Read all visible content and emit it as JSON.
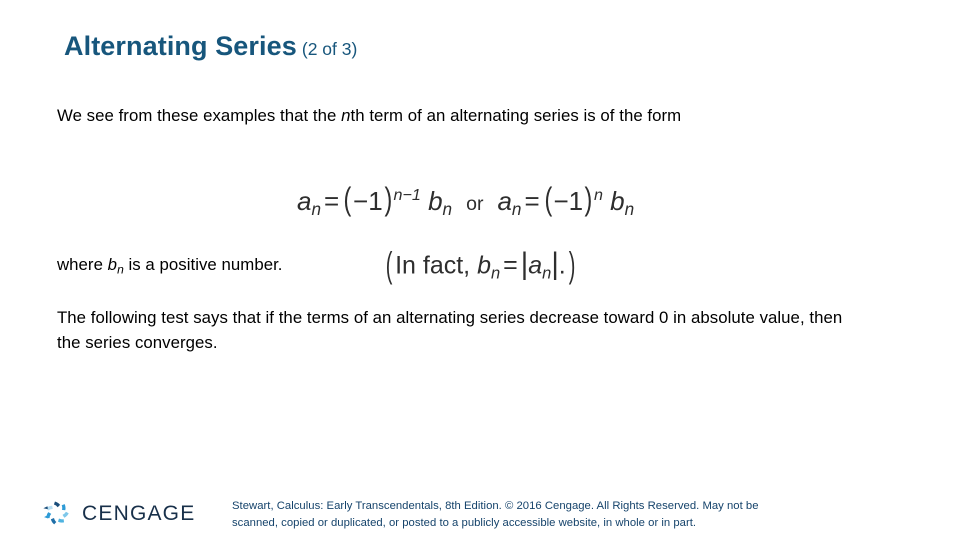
{
  "slide": {
    "title": "Alternating Series",
    "title_subtitle": "(2 of 3)",
    "title_color": "#17567c",
    "background_color": "#ffffff"
  },
  "body": {
    "paragraph_1": {
      "before_italic": "We see from these examples that the ",
      "italic_var": "n",
      "after_italic": "th term of an alternating series is of the form",
      "full_text": "We see from these examples that the nth term of an alternating series is of the form"
    },
    "where_line": {
      "prefix": "where ",
      "var": "b",
      "var_sub": "n",
      "suffix": " is a positive number.",
      "full_text": "where bn is a positive number."
    },
    "paragraph_2": "The following test says that if the terms of an alternating series decrease toward 0 in absolute value, then the series converges."
  },
  "equations": {
    "main": {
      "lhs_var_1": "a",
      "lhs_sub_1": "n",
      "equals": "=",
      "open_paren": "(",
      "minus_one": "−1",
      "close_paren": ")",
      "exponent_1": "n−1",
      "rhs_var_1": "b",
      "rhs_sub_1": "n",
      "connector": "or",
      "lhs_var_2": "a",
      "lhs_sub_2": "n",
      "exponent_2": "n",
      "rhs_var_2": "b",
      "rhs_sub_2": "n",
      "plain_text": "a_n = (−1)^(n−1) b_n   or   a_n = (−1)^n b_n"
    },
    "inline_note": {
      "open_paren": "(",
      "text": "In fact, ",
      "var_b": "b",
      "sub_b": "n",
      "equals": "=",
      "bar_left": "|",
      "var_a": "a",
      "sub_a": "n",
      "bar_right": "|",
      "period": ".",
      "close_paren": ")",
      "plain_text": "(In fact, b_n = |a_n|.)"
    }
  },
  "footer": {
    "credit_line_1": "Stewart, Calculus: Early Transcendentals, 8th Edition. © 2016 Cengage. All Rights Reserved. May not be",
    "credit_line_2": "scanned, copied or duplicated, or posted to a publicly accessible website, in whole or in part.",
    "credit_color": "#15436b",
    "logo_wordmark": "CENGAGE",
    "logo_word_color": "#18304a",
    "logo_mark_colors": [
      "#1a4d7a",
      "#2e9bd6",
      "#7fc8ea",
      "#4fb3e0",
      "#b9dff3",
      "#1f6fa8"
    ]
  }
}
